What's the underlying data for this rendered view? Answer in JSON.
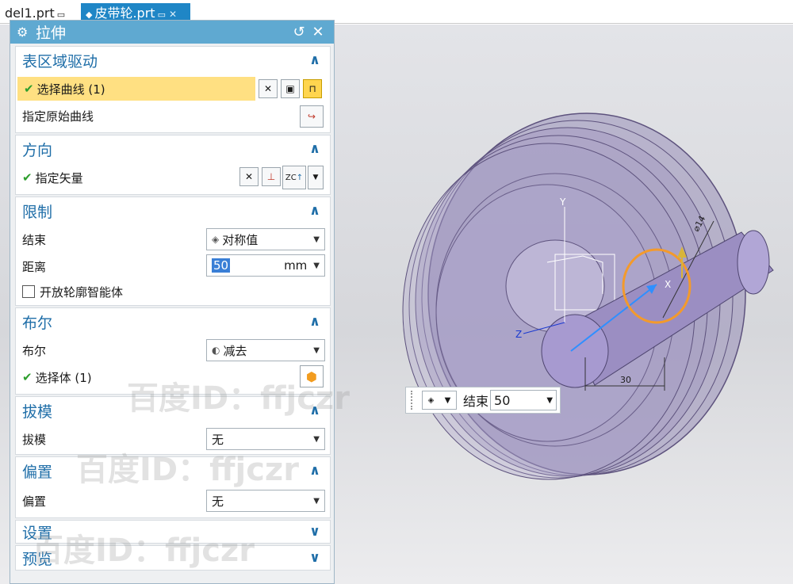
{
  "tabs": [
    {
      "label": "del1.prt",
      "icon": "document-icon"
    },
    {
      "label": "皮带轮.prt",
      "icon": "part-icon"
    }
  ],
  "dialog": {
    "title": "拉伸",
    "sections": {
      "surface_drive": {
        "title": "表区域驱动",
        "select_curve": "选择曲线 (1)",
        "origin_curve": "指定原始曲线"
      },
      "direction": {
        "title": "方向",
        "vector": "指定矢量",
        "zc_label": "ZC"
      },
      "limits": {
        "title": "限制",
        "end_label": "结束",
        "end_value": "对称值",
        "distance_label": "距离",
        "distance_value": "50",
        "distance_unit": "mm",
        "open_profile": "开放轮廓智能体"
      },
      "boolean": {
        "title": "布尔",
        "boolean_label": "布尔",
        "boolean_value": "减去",
        "select_body": "选择体 (1)"
      },
      "draft": {
        "title": "拔模",
        "label": "拔模",
        "value": "无"
      },
      "offset": {
        "title": "偏置",
        "label": "偏置",
        "value": "无"
      },
      "settings": {
        "title": "设置"
      },
      "preview": {
        "title": "预览"
      }
    }
  },
  "floating_toolbar": {
    "end_label": "结束",
    "end_value": "50"
  },
  "viewport": {
    "axes": {
      "x": "X",
      "y": "Y",
      "z": "Z"
    },
    "dim_length": "30",
    "dim_diameter": "⌀14"
  },
  "watermark": "百度ID：ffjczr",
  "colors": {
    "title_bar": "#5fa9d1",
    "active_tab": "#1f86c6",
    "section_title": "#1f6ea8",
    "selection_row": "#ffe082",
    "part_fill": "#8e7fb4",
    "highlight_circle": "#f39a2c",
    "vector_arrow": "#2f8fff"
  }
}
